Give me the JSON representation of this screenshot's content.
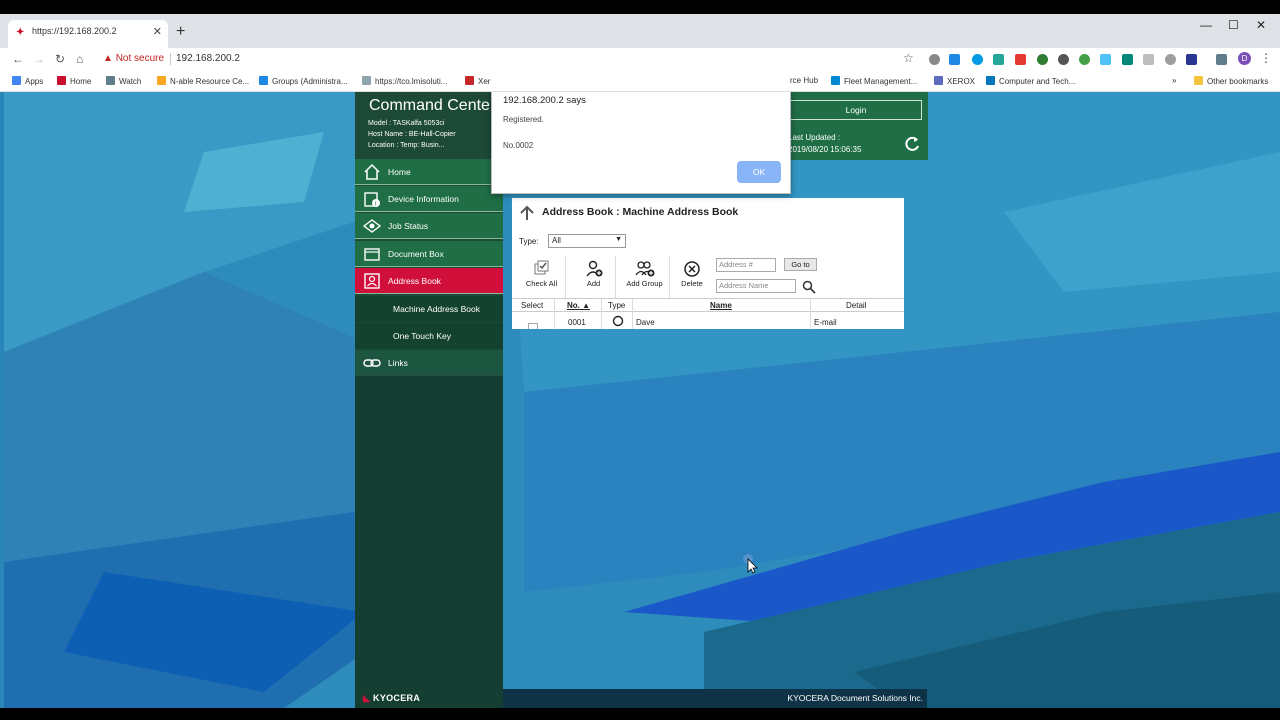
{
  "browser": {
    "tab_title": "https://192.168.200.2",
    "new_tab": "+",
    "window_controls": [
      "—",
      "☐",
      "✕"
    ],
    "security_label": "Not secure",
    "url": "192.168.200.2",
    "bookmarks": [
      {
        "label": "Apps",
        "color": "#4285f4"
      },
      {
        "label": "Home",
        "color": "#c8102e"
      },
      {
        "label": "Watch",
        "color": "#607d8b"
      },
      {
        "label": "N-able Resource Ce...",
        "color": "#f9a825"
      },
      {
        "label": "Groups (Administra...",
        "color": "#1e88e5"
      },
      {
        "label": "https://tco.lmisoluti...",
        "color": "#90a4ae"
      },
      {
        "label": "Xer",
        "color": "#c62828"
      },
      {
        "label": "rce Hub",
        "color": "#ffffff"
      },
      {
        "label": "Fleet Management...",
        "color": "#0288d1"
      },
      {
        "label": "XEROX",
        "color": "#5c6bc0"
      },
      {
        "label": "Computer and Tech...",
        "color": "#0277bd"
      }
    ],
    "more_bookmarks": "»",
    "other_bookmarks": "Other bookmarks"
  },
  "header": {
    "brand": "Command Center",
    "model": "Model : TASKalfa 5053ci",
    "host": "Host Name : BE-Hall-Copier",
    "location": "Location : Temp: Busin...",
    "login": "Login",
    "last_updated_label": "Last Updated :",
    "last_updated_value": "2019/08/20 15:06:35"
  },
  "sidebar": {
    "items": [
      {
        "label": "Home",
        "icon": "home-icon"
      },
      {
        "label": "Device Information",
        "icon": "device-info-icon"
      },
      {
        "label": "Job Status",
        "icon": "job-status-icon"
      },
      {
        "label": "Document Box",
        "icon": "document-box-icon"
      },
      {
        "label": "Address Book",
        "icon": "address-book-icon"
      }
    ],
    "subitems": [
      "Machine Address Book",
      "One Touch Key"
    ],
    "links": "Links",
    "logo": "KYOCERA"
  },
  "panel": {
    "title": "Address Book : Machine Address Book",
    "type_label": "Type:",
    "type_value": "All",
    "tools": [
      "Check All",
      "Add",
      "Add Group",
      "Delete"
    ],
    "address_number_placeholder": "Address #",
    "address_name_placeholder": "Address Name",
    "goto": "Go to",
    "columns": [
      "Select",
      "No.",
      "Type",
      "Name",
      "Detail"
    ],
    "rows": [
      {
        "no": "0001",
        "name": "Dave",
        "detail": "E-mail"
      }
    ]
  },
  "dialog": {
    "title": "192.168.200.2 says",
    "message": "Registered.",
    "number": "No.0002",
    "ok": "OK"
  },
  "footer": {
    "copyright": "KYOCERA Document Solutions Inc."
  },
  "colors": {
    "sidebar_green": "#1f6e46",
    "active_red": "#d0103a",
    "dialog_ok": "#8ab4f8"
  }
}
